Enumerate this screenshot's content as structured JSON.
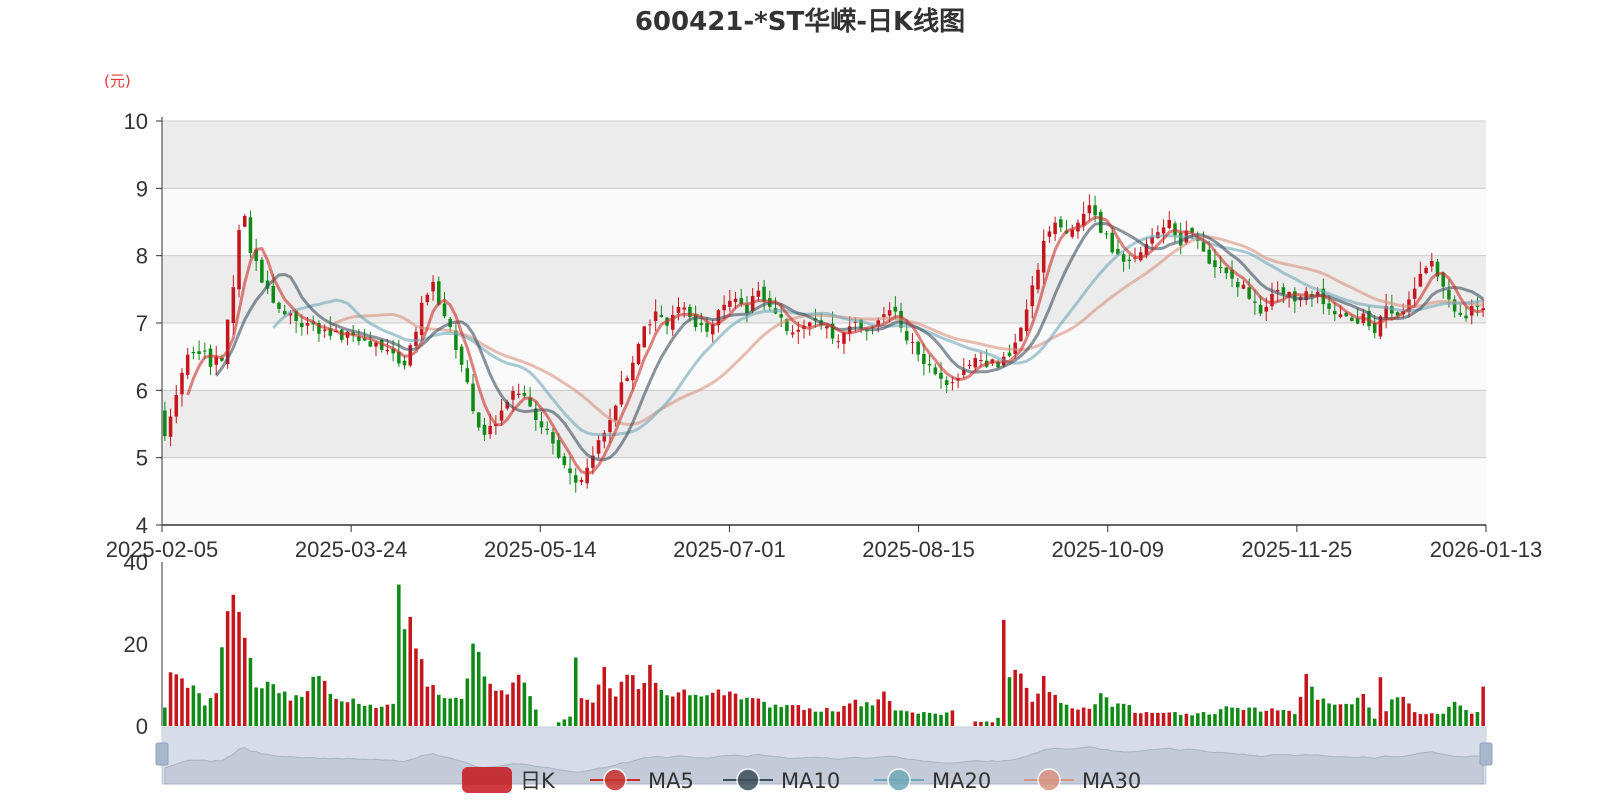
{
  "chart_data": {
    "type": "candlestick",
    "title": "600421-*ST华嵘-日K线图",
    "y_unit": "(元)",
    "price_axis": {
      "ylim": [
        4,
        10
      ],
      "ticks": [
        "4",
        "5",
        "6",
        "7",
        "8",
        "9",
        "10"
      ]
    },
    "volume_axis": {
      "ylim": [
        0,
        40
      ],
      "ticks": [
        "0",
        "20",
        "40"
      ]
    },
    "x_ticks": [
      "2025-02-05",
      "2025-03-24",
      "2025-05-14",
      "2025-07-01",
      "2025-08-15",
      "2025-10-09",
      "2025-11-25",
      "2026-01-13"
    ],
    "legend": [
      "日K",
      "MA5",
      "MA10",
      "MA20",
      "MA30"
    ],
    "colors": {
      "up": "#c4161c",
      "down": "#0f8a16",
      "MA5": "#c9302c",
      "MA10": "#3c4f5c",
      "MA20": "#6fa8b8",
      "MA30": "#d99281",
      "band_light": "#fafafa",
      "band_dark": "#ececec"
    },
    "grid": true,
    "legend_position": "bottom-center",
    "n_days": 232,
    "close_anchors": [
      [
        0,
        5.4
      ],
      [
        2,
        5.9
      ],
      [
        4,
        6.5
      ],
      [
        6,
        6.6
      ],
      [
        8,
        6.4
      ],
      [
        10,
        6.5
      ],
      [
        12,
        7.6
      ],
      [
        13,
        8.3
      ],
      [
        14,
        8.6
      ],
      [
        15,
        8.1
      ],
      [
        17,
        7.6
      ],
      [
        19,
        7.3
      ],
      [
        22,
        7.1
      ],
      [
        26,
        6.9
      ],
      [
        30,
        6.8
      ],
      [
        34,
        6.8
      ],
      [
        38,
        6.6
      ],
      [
        42,
        6.4
      ],
      [
        44,
        6.9
      ],
      [
        45,
        7.3
      ],
      [
        47,
        7.6
      ],
      [
        48,
        7.3
      ],
      [
        50,
        6.9
      ],
      [
        52,
        6.4
      ],
      [
        54,
        5.7
      ],
      [
        56,
        5.3
      ],
      [
        58,
        5.5
      ],
      [
        60,
        5.9
      ],
      [
        62,
        6.0
      ],
      [
        64,
        5.7
      ],
      [
        66,
        5.5
      ],
      [
        68,
        5.2
      ],
      [
        70,
        4.9
      ],
      [
        72,
        4.6
      ],
      [
        74,
        4.8
      ],
      [
        76,
        5.2
      ],
      [
        78,
        5.6
      ],
      [
        80,
        6.1
      ],
      [
        82,
        6.4
      ],
      [
        84,
        6.9
      ],
      [
        86,
        7.1
      ],
      [
        88,
        7.0
      ],
      [
        90,
        7.3
      ],
      [
        92,
        7.1
      ],
      [
        94,
        6.9
      ],
      [
        96,
        7.0
      ],
      [
        98,
        7.3
      ],
      [
        100,
        7.4
      ],
      [
        102,
        7.2
      ],
      [
        104,
        7.5
      ],
      [
        106,
        7.3
      ],
      [
        108,
        7.1
      ],
      [
        110,
        6.8
      ],
      [
        112,
        6.9
      ],
      [
        114,
        7.0
      ],
      [
        116,
        6.9
      ],
      [
        118,
        6.8
      ],
      [
        120,
        7.0
      ],
      [
        122,
        6.9
      ],
      [
        124,
        7.0
      ],
      [
        126,
        7.2
      ],
      [
        128,
        7.1
      ],
      [
        130,
        6.8
      ],
      [
        132,
        6.5
      ],
      [
        134,
        6.3
      ],
      [
        136,
        6.2
      ],
      [
        138,
        6.1
      ],
      [
        140,
        6.3
      ],
      [
        142,
        6.4
      ],
      [
        144,
        6.4
      ],
      [
        146,
        6.4
      ],
      [
        148,
        6.5
      ],
      [
        150,
        6.9
      ],
      [
        152,
        7.5
      ],
      [
        154,
        8.2
      ],
      [
        156,
        8.5
      ],
      [
        158,
        8.3
      ],
      [
        160,
        8.5
      ],
      [
        162,
        8.8
      ],
      [
        164,
        8.4
      ],
      [
        166,
        8.1
      ],
      [
        168,
        7.9
      ],
      [
        170,
        8.0
      ],
      [
        172,
        8.2
      ],
      [
        174,
        8.4
      ],
      [
        176,
        8.5
      ],
      [
        178,
        8.2
      ],
      [
        180,
        8.4
      ],
      [
        182,
        8.0
      ],
      [
        184,
        7.8
      ],
      [
        186,
        7.7
      ],
      [
        188,
        7.6
      ],
      [
        190,
        7.4
      ],
      [
        192,
        7.2
      ],
      [
        194,
        7.4
      ],
      [
        196,
        7.5
      ],
      [
        198,
        7.3
      ],
      [
        200,
        7.5
      ],
      [
        202,
        7.4
      ],
      [
        204,
        7.2
      ],
      [
        206,
        7.1
      ],
      [
        208,
        7.0
      ],
      [
        210,
        7.1
      ],
      [
        212,
        6.9
      ],
      [
        214,
        7.3
      ],
      [
        216,
        7.1
      ],
      [
        218,
        7.4
      ],
      [
        220,
        7.7
      ],
      [
        222,
        7.9
      ],
      [
        224,
        7.5
      ],
      [
        226,
        7.2
      ],
      [
        228,
        7.1
      ],
      [
        230,
        7.3
      ],
      [
        231,
        7.2
      ]
    ],
    "volume_anchors": [
      [
        0,
        4
      ],
      [
        1,
        12
      ],
      [
        3,
        12
      ],
      [
        5,
        9
      ],
      [
        7,
        5
      ],
      [
        9,
        7
      ],
      [
        10,
        20
      ],
      [
        11,
        32
      ],
      [
        12,
        36
      ],
      [
        13,
        26
      ],
      [
        14,
        20
      ],
      [
        15,
        15
      ],
      [
        16,
        11
      ],
      [
        18,
        10
      ],
      [
        20,
        9
      ],
      [
        22,
        7
      ],
      [
        25,
        8
      ],
      [
        27,
        13
      ],
      [
        29,
        7
      ],
      [
        33,
        6
      ],
      [
        37,
        5
      ],
      [
        40,
        6
      ],
      [
        41,
        30
      ],
      [
        42,
        24
      ],
      [
        43,
        26
      ],
      [
        44,
        20
      ],
      [
        45,
        17
      ],
      [
        46,
        10
      ],
      [
        48,
        8
      ],
      [
        52,
        7
      ],
      [
        54,
        18
      ],
      [
        55,
        18
      ],
      [
        57,
        9
      ],
      [
        60,
        8
      ],
      [
        62,
        12
      ],
      [
        64,
        7
      ],
      [
        66,
        0
      ],
      [
        68,
        0
      ],
      [
        69,
        1
      ],
      [
        71,
        2
      ],
      [
        72,
        19
      ],
      [
        73,
        8
      ],
      [
        75,
        5
      ],
      [
        77,
        13
      ],
      [
        79,
        7
      ],
      [
        81,
        14
      ],
      [
        83,
        9
      ],
      [
        85,
        13
      ],
      [
        87,
        9
      ],
      [
        90,
        8
      ],
      [
        94,
        8
      ],
      [
        98,
        8
      ],
      [
        102,
        7
      ],
      [
        106,
        5
      ],
      [
        110,
        5
      ],
      [
        114,
        4
      ],
      [
        118,
        4
      ],
      [
        121,
        6
      ],
      [
        124,
        5
      ],
      [
        126,
        8
      ],
      [
        128,
        4
      ],
      [
        132,
        3
      ],
      [
        136,
        3
      ],
      [
        138,
        4
      ],
      [
        139,
        0
      ],
      [
        141,
        0
      ],
      [
        142,
        1
      ],
      [
        144,
        1
      ],
      [
        145,
        1
      ],
      [
        146,
        2
      ],
      [
        147,
        25
      ],
      [
        148,
        11
      ],
      [
        150,
        13
      ],
      [
        152,
        6
      ],
      [
        154,
        11
      ],
      [
        156,
        7
      ],
      [
        158,
        5
      ],
      [
        162,
        4
      ],
      [
        164,
        8
      ],
      [
        166,
        5
      ],
      [
        168,
        6
      ],
      [
        170,
        3
      ],
      [
        172,
        3
      ],
      [
        176,
        3
      ],
      [
        180,
        3
      ],
      [
        184,
        3
      ],
      [
        186,
        5
      ],
      [
        188,
        4
      ],
      [
        190,
        5
      ],
      [
        192,
        4
      ],
      [
        194,
        4
      ],
      [
        196,
        4
      ],
      [
        198,
        3
      ],
      [
        200,
        12
      ],
      [
        202,
        7
      ],
      [
        204,
        5
      ],
      [
        206,
        5
      ],
      [
        208,
        6
      ],
      [
        210,
        8
      ],
      [
        212,
        2
      ],
      [
        213,
        12
      ],
      [
        214,
        4
      ],
      [
        216,
        8
      ],
      [
        218,
        5
      ],
      [
        220,
        3
      ],
      [
        224,
        3
      ],
      [
        226,
        6
      ],
      [
        228,
        4
      ],
      [
        230,
        3
      ],
      [
        231,
        10
      ]
    ]
  }
}
